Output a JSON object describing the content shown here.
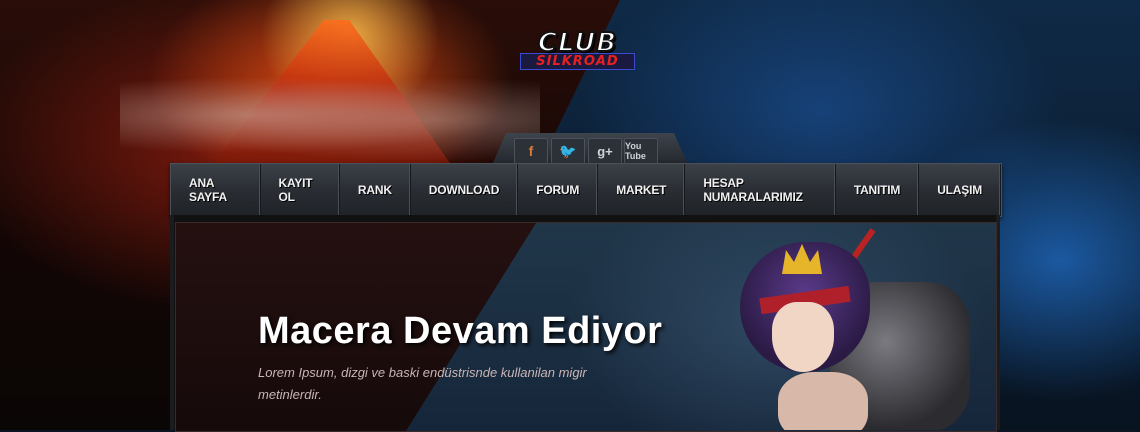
{
  "logo": {
    "top_text": "CLUB",
    "bottom_text": "SILKROAD"
  },
  "social": [
    {
      "icon": "facebook-icon",
      "glyph": "f"
    },
    {
      "icon": "twitter-icon",
      "glyph": "🐦"
    },
    {
      "icon": "google-plus-icon",
      "glyph": "g+"
    },
    {
      "icon": "youtube-icon",
      "glyph": "You Tube"
    }
  ],
  "nav": {
    "items": [
      "ANA SAYFA",
      "KAYIT OL",
      "RANK",
      "DOWNLOAD",
      "FORUM",
      "MARKET",
      "HESAP NUMARALARIMIZ",
      "TANITIM",
      "ULAŞIM"
    ]
  },
  "hero": {
    "title": "Macera Devam Ediyor",
    "description": "Lorem Ipsum, dizgi ve baski endüstrisnde kullanilan migir metinlerdir."
  },
  "colors": {
    "lava": "#ff6b1a",
    "tech_blue": "#1e6fd8",
    "nav_bg": "#2a2e34",
    "text": "#ffffff"
  }
}
